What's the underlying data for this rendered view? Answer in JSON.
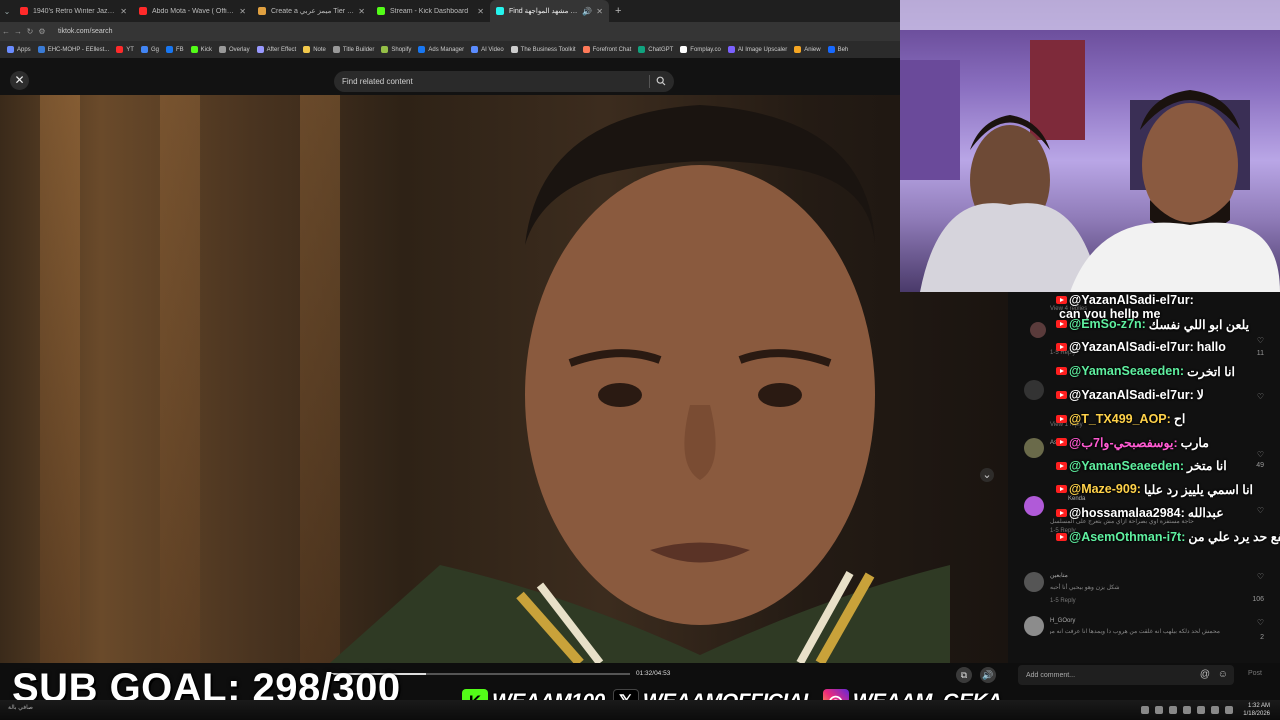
{
  "browser": {
    "tabs": [
      {
        "title": "1940's Retro Winter Jazz Mi",
        "color": "#ff2a2a",
        "active": false
      },
      {
        "title": "Abdo Mota - Wave ( Official m",
        "color": "#ff2a2a",
        "active": false
      },
      {
        "title": "Create a ميمز عربي Tier List - TierM",
        "color": "#e0a040",
        "active": false
      },
      {
        "title": "Stream - Kick Dashboard",
        "color": "#53fc18",
        "active": false
      },
      {
        "title": "Find تحويل مشهد المواجهة",
        "color": "#25f4ee",
        "active": true
      }
    ],
    "url": "tiktok.com/search",
    "bookmarks": [
      {
        "label": "Apps",
        "color": "#6a8cff"
      },
      {
        "label": "EHC-MOHP - EEllest...",
        "color": "#3a7bd5"
      },
      {
        "label": "YT",
        "color": "#ff2a2a"
      },
      {
        "label": "Gg",
        "color": "#4285f4"
      },
      {
        "label": "FB",
        "color": "#1877f2"
      },
      {
        "label": "Kick",
        "color": "#53fc18"
      },
      {
        "label": "Overlay",
        "color": "#999999"
      },
      {
        "label": "After Effect",
        "color": "#9999ff"
      },
      {
        "label": "Note",
        "color": "#f2c94c"
      },
      {
        "label": "Title Builder",
        "color": "#999999"
      },
      {
        "label": "Shopify",
        "color": "#95bf47"
      },
      {
        "label": "Ads Manager",
        "color": "#1877f2"
      },
      {
        "label": "AI Video",
        "color": "#5b8cff"
      },
      {
        "label": "The Business Toolkit",
        "color": "#cccccc"
      },
      {
        "label": "Forefront Chat",
        "color": "#ff7a59"
      },
      {
        "label": "ChatGPT",
        "color": "#10a37f"
      },
      {
        "label": "Fomplay.co",
        "color": "#ffffff"
      },
      {
        "label": "AI Image Upscaler",
        "color": "#7b61ff"
      },
      {
        "label": "Aniew",
        "color": "#f5a623"
      },
      {
        "label": "Beh",
        "color": "#1769ff"
      }
    ]
  },
  "tiktok": {
    "search_placeholder": "Find related content",
    "progress_fraction": 0.32,
    "timecode": "01:32/04:53",
    "add_comment_placeholder": "Add comment...",
    "post_label": "Post",
    "comments": [
      {
        "name": "",
        "text": "View 4 replies",
        "reply": "",
        "likes": ""
      },
      {
        "name": "",
        "text": "",
        "reply": "1-5   Reply",
        "likes": "11"
      },
      {
        "name": "",
        "text": "انا اتخرت",
        "reply": "View 1 reply",
        "likes": ""
      },
      {
        "name": "Asem",
        "text": "",
        "reply": "",
        "likes": "49"
      },
      {
        "name": "Kenda",
        "text": "حاجة مستفزة اوي بصراحة ازاي مش بتعرج على المسلسل",
        "reply": "1-5   Reply",
        "likes": ""
      },
      {
        "name": "متابعين",
        "text": "شكل يزن وهو بيحبي أنا أحبه",
        "reply": "1-5   Reply",
        "likes": "106"
      },
      {
        "name": "H_GOory",
        "text": "محمش لحد دلكه بيلهب انه غلقت من هروب دا ويمدها انا عرفت انه من دلاقتي...",
        "reply": "",
        "likes": "2"
      }
    ]
  },
  "chat": [
    {
      "user": "@YazanAlSadi-el7ur:",
      "text": "can you hellp me",
      "color": "white",
      "rtl": false
    },
    {
      "user": "@EmSo-z7n:",
      "text": "يلعن ابو اللي نفسك",
      "color": "green",
      "rtl": true
    },
    {
      "user": "@YazanAlSadi-el7ur:",
      "text": "hallo",
      "color": "white",
      "rtl": false
    },
    {
      "user": "@YamanSeaeeden:",
      "text": "انا اتخرت",
      "color": "green",
      "rtl": true
    },
    {
      "user": "@YazanAlSadi-el7ur:",
      "text": "لا",
      "color": "white",
      "rtl": true
    },
    {
      "user": "@T_TX499_AOP:",
      "text": "اح",
      "color": "yellow",
      "rtl": true
    },
    {
      "user": "@يوسفصبحي-وا7ب:",
      "text": "مارب",
      "color": "pink",
      "rtl": true
    },
    {
      "user": "@YamanSeaeeden:",
      "text": "انا متخر",
      "color": "green",
      "rtl": true
    },
    {
      "user": "@Maze-909:",
      "text": "انا اسمي يلييز رد عليا",
      "color": "yellow",
      "rtl": true
    },
    {
      "user": "@hossamalaa2984:",
      "text": "عبدالله",
      "color": "white",
      "rtl": true
    },
    {
      "user": "@AsemOthman-i7t:",
      "text": "ينفع حد يرد علي من",
      "color": "green",
      "rtl": true
    }
  ],
  "overlay": {
    "sub_goal": "SUB GOAL: 298/300",
    "kick_handle": "WEAAM100",
    "x_handle": "WEAAMOFFICIAL",
    "ig_handle": "WEAAM_GEKA",
    "kick_color": "#53fc18"
  },
  "taskbar": {
    "left_text": "صافي بالة",
    "time": "1:32 AM",
    "date": "1/18/2026"
  }
}
